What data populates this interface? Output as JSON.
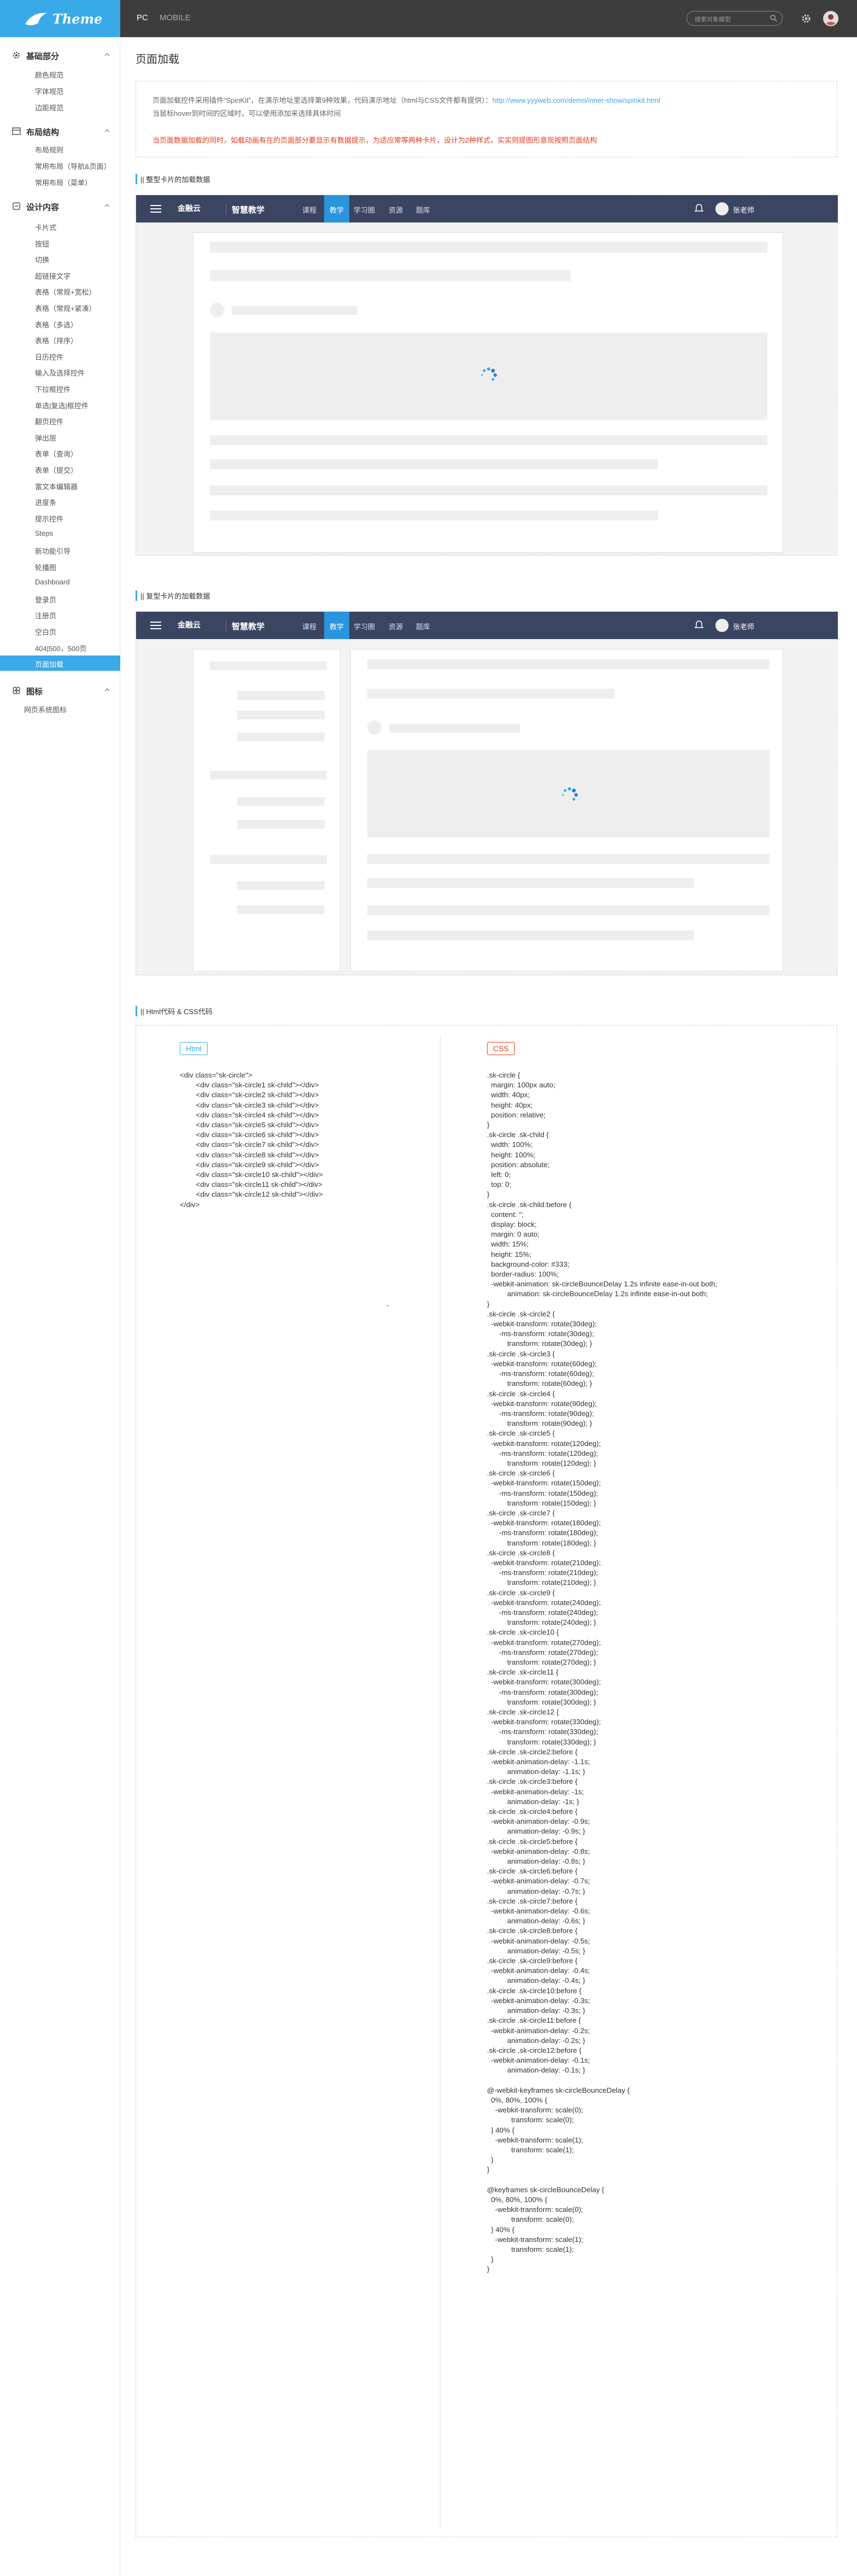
{
  "header": {
    "logo_text": "Theme",
    "tabs": [
      "PC",
      "MOBILE"
    ],
    "search_placeholder": "搜索对象模型",
    "avatar_icon": "user-avatar",
    "settings_icon": "gear-icon"
  },
  "sidebar": {
    "groups": [
      {
        "label": "基础部分",
        "icon": "gear-icon"
      },
      {
        "label": "布局结构",
        "icon": "layout-icon"
      },
      {
        "label": "设计内容",
        "icon": "palette-icon"
      },
      {
        "label": "图标",
        "icon": "puzzle-icon"
      }
    ],
    "items_basic": [
      "颜色规范",
      "字体规范",
      "边距规范"
    ],
    "items_layout": [
      "布局规则",
      "常用布局（导航&页面）",
      "常用布局（菜单）"
    ],
    "items_design": [
      "卡片式",
      "按钮",
      "切换",
      "超链接文字",
      "表格（常规+宽松）",
      "表格（常规+紧凑）",
      "表格（多选）",
      "表格（排序）",
      "日历控件",
      "输入及选择控件",
      "下拉框控件",
      "单选|复选|框控件",
      "翻页控件",
      "弹出层",
      "表单（查询）",
      "表单（提交）",
      "富文本编辑器",
      "进度条",
      "提示控件",
      "Steps",
      "新功能引导",
      "轮播图",
      "Dashboard",
      "登录页",
      "注册页",
      "空白页",
      "404|500，500页",
      "页面加载"
    ],
    "items_icons": [
      "网页系统图标"
    ],
    "active": "页面加载"
  },
  "main": {
    "title": "页面加载",
    "intro_line1": "页面加载控件采用插件“SpinKit”，在演示地址里选择第9种效果，代码演示地址（html与CSS文件都有提供）：",
    "intro_link": "http://www.yyyweb.com/demo/inner-show/spinkit.html",
    "intro_line2": "当鼠标hover到时间的区域时，可以使用添加来选择具体时间",
    "intro_warning": "当页面数据加载的同时，如载动画有在的页面部分要显示有数据提示，为适应常等两种卡片，设计为2种样式，实实则提图形意现按照页面结构",
    "section1": "|| 整型卡片的加载数据",
    "section2": "|| 复型卡片的加载数据",
    "section3": "|| Html代码 & CSS代码",
    "demo_nav": {
      "logo": "金融云",
      "brand": "智慧教学",
      "items": [
        "课程",
        "教学",
        "学习圈",
        "资源",
        "题库"
      ],
      "active_index": 1,
      "user": "张老师"
    }
  },
  "code": {
    "html_label": "Html",
    "css_label": "CSS",
    "html_lines": [
      "<div class=\"sk-circle\">",
      "        <div class=\"sk-circle1 sk-child\"></div>",
      "        <div class=\"sk-circle2 sk-child\"></div>",
      "        <div class=\"sk-circle3 sk-child\"></div>",
      "        <div class=\"sk-circle4 sk-child\"></div>",
      "        <div class=\"sk-circle5 sk-child\"></div>",
      "        <div class=\"sk-circle6 sk-child\"></div>",
      "        <div class=\"sk-circle7 sk-child\"></div>",
      "        <div class=\"sk-circle8 sk-child\"></div>",
      "        <div class=\"sk-circle9 sk-child\"></div>",
      "        <div class=\"sk-circle10 sk-child\"></div>",
      "        <div class=\"sk-circle11 sk-child\"></div>",
      "        <div class=\"sk-circle12 sk-child\"></div>",
      "</div>"
    ],
    "css_lines": [
      ".sk-circle {",
      "  margin: 100px auto;",
      "  width: 40px;",
      "  height: 40px;",
      "  position: relative;",
      "}",
      ".sk-circle .sk-child {",
      "  width: 100%;",
      "  height: 100%;",
      "  position: absolute;",
      "  left: 0;",
      "  top: 0;",
      "}",
      ".sk-circle .sk-child:before {",
      "  content: '';",
      "  display: block;",
      "  margin: 0 auto;",
      "  width: 15%;",
      "  height: 15%;",
      "  background-color: #333;",
      "  border-radius: 100%;",
      "  -webkit-animation: sk-circleBounceDelay 1.2s infinite ease-in-out both;",
      "          animation: sk-circleBounceDelay 1.2s infinite ease-in-out both;",
      "}",
      ".sk-circle .sk-circle2 {",
      "  -webkit-transform: rotate(30deg);",
      "      -ms-transform: rotate(30deg);",
      "          transform: rotate(30deg); }",
      ".sk-circle .sk-circle3 {",
      "  -webkit-transform: rotate(60deg);",
      "      -ms-transform: rotate(60deg);",
      "          transform: rotate(60deg); }",
      ".sk-circle .sk-circle4 {",
      "  -webkit-transform: rotate(90deg);",
      "      -ms-transform: rotate(90deg);",
      "          transform: rotate(90deg); }",
      ".sk-circle .sk-circle5 {",
      "  -webkit-transform: rotate(120deg);",
      "      -ms-transform: rotate(120deg);",
      "          transform: rotate(120deg); }",
      ".sk-circle .sk-circle6 {",
      "  -webkit-transform: rotate(150deg);",
      "      -ms-transform: rotate(150deg);",
      "          transform: rotate(150deg); }",
      ".sk-circle .sk-circle7 {",
      "  -webkit-transform: rotate(180deg);",
      "      -ms-transform: rotate(180deg);",
      "          transform: rotate(180deg); }",
      ".sk-circle .sk-circle8 {",
      "  -webkit-transform: rotate(210deg);",
      "      -ms-transform: rotate(210deg);",
      "          transform: rotate(210deg); }",
      ".sk-circle .sk-circle9 {",
      "  -webkit-transform: rotate(240deg);",
      "      -ms-transform: rotate(240deg);",
      "          transform: rotate(240deg); }",
      ".sk-circle .sk-circle10 {",
      "  -webkit-transform: rotate(270deg);",
      "      -ms-transform: rotate(270deg);",
      "          transform: rotate(270deg); }",
      ".sk-circle .sk-circle11 {",
      "  -webkit-transform: rotate(300deg);",
      "      -ms-transform: rotate(300deg);",
      "          transform: rotate(300deg); }",
      ".sk-circle .sk-circle12 {",
      "  -webkit-transform: rotate(330deg);",
      "      -ms-transform: rotate(330deg);",
      "          transform: rotate(330deg); }",
      ".sk-circle .sk-circle2:before {",
      "  -webkit-animation-delay: -1.1s;",
      "          animation-delay: -1.1s; }",
      ".sk-circle .sk-circle3:before {",
      "  -webkit-animation-delay: -1s;",
      "          animation-delay: -1s; }",
      ".sk-circle .sk-circle4:before {",
      "  -webkit-animation-delay: -0.9s;",
      "          animation-delay: -0.9s; }",
      ".sk-circle .sk-circle5:before {",
      "  -webkit-animation-delay: -0.8s;",
      "          animation-delay: -0.8s; }",
      ".sk-circle .sk-circle6:before {",
      "  -webkit-animation-delay: -0.7s;",
      "          animation-delay: -0.7s; }",
      ".sk-circle .sk-circle7:before {",
      "  -webkit-animation-delay: -0.6s;",
      "          animation-delay: -0.6s; }",
      ".sk-circle .sk-circle8:before {",
      "  -webkit-animation-delay: -0.5s;",
      "          animation-delay: -0.5s; }",
      ".sk-circle .sk-circle9:before {",
      "  -webkit-animation-delay: -0.4s;",
      "          animation-delay: -0.4s; }",
      ".sk-circle .sk-circle10:before {",
      "  -webkit-animation-delay: -0.3s;",
      "          animation-delay: -0.3s; }",
      ".sk-circle .sk-circle11:before {",
      "  -webkit-animation-delay: -0.2s;",
      "          animation-delay: -0.2s; }",
      ".sk-circle .sk-circle12:before {",
      "  -webkit-animation-delay: -0.1s;",
      "          animation-delay: -0.1s; }",
      "",
      "@-webkit-keyframes sk-circleBounceDelay {",
      "  0%, 80%, 100% {",
      "    -webkit-transform: scale(0);",
      "            transform: scale(0);",
      "  } 40% {",
      "    -webkit-transform: scale(1);",
      "            transform: scale(1);",
      "  }",
      "}",
      "",
      "@keyframes sk-circleBounceDelay {",
      "  0%, 80%, 100% {",
      "    -webkit-transform: scale(0);",
      "            transform: scale(0);",
      "  } 40% {",
      "    -webkit-transform: scale(1);",
      "            transform: scale(1);",
      "  }",
      "}"
    ]
  },
  "colors": {
    "brand": "#3aa9e8",
    "topbar": "#3d3d3d",
    "demo_nav": "#3a4562",
    "warning": "#e53b1b"
  }
}
